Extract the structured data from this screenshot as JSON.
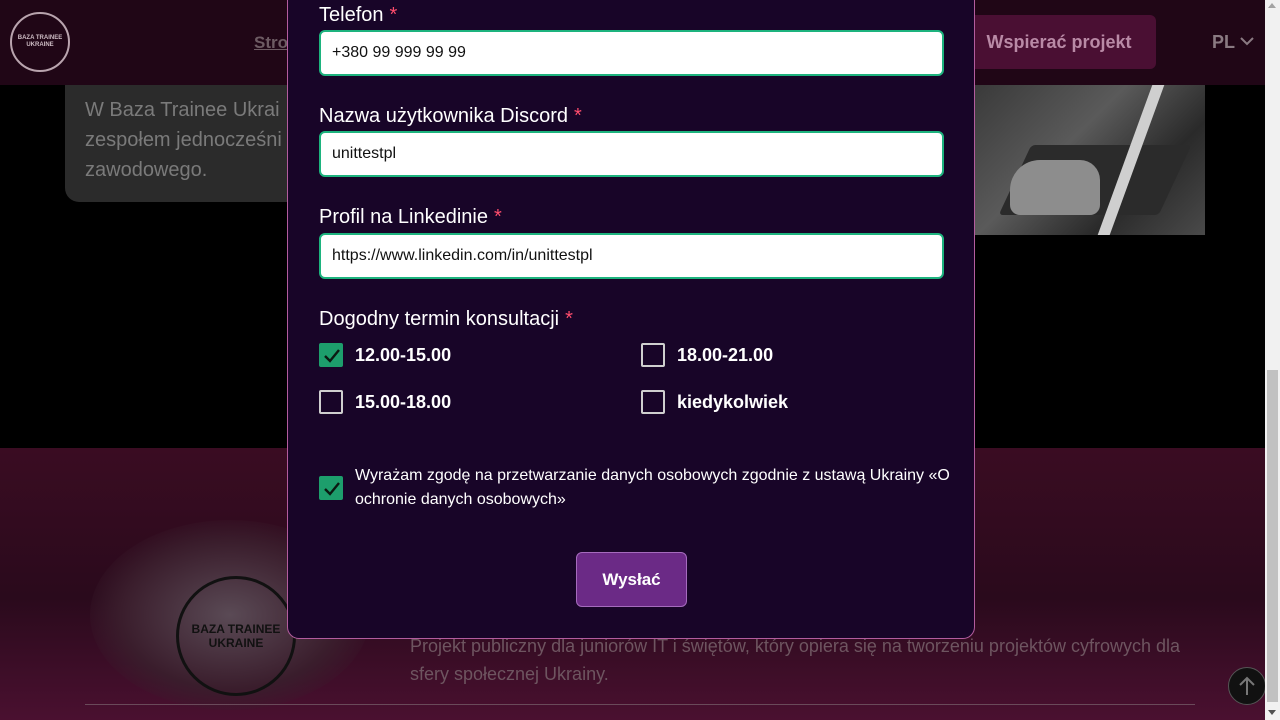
{
  "header": {
    "logo_text": "BAZA TRAINEE UKRAINE",
    "nav_link": "Stro",
    "support_label": "Wspierać projekt",
    "lang": "PL"
  },
  "about": {
    "text": "W Baza Trainee Ukrai zespołem jednocześni zawodowego."
  },
  "form": {
    "phone_label": "Telefon",
    "phone_value": "+380 99 999 99 99",
    "discord_label": "Nazwa użytkownika Discord",
    "discord_value": "unittestpl",
    "linkedin_label": "Profil na Linkedinie",
    "linkedin_value": "https://www.linkedin.com/in/unittestpl",
    "required_mark": "*",
    "time_label": "Dogodny termin konsultacji",
    "time_options": [
      {
        "label": "12.00-15.00",
        "checked": true
      },
      {
        "label": "18.00-21.00",
        "checked": false
      },
      {
        "label": "15.00-18.00",
        "checked": false
      },
      {
        "label": "kiedykolwiek",
        "checked": false
      }
    ],
    "consent_text": "Wyrażam zgodę na przetwarzanie danych osobowych zgodnie z ustawą Ukrainy «O ochronie danych osobowych»",
    "consent_checked": true,
    "submit_label": "Wysłać"
  },
  "footer": {
    "logo_text": "BAZA TRAINEE UKRAINE",
    "description": "Projekt publiczny dla juniorów IT i świętów, który opiera się na tworzeniu projektów cyfrowych dla sfery społecznej Ukrainy."
  },
  "colors": {
    "accent_green": "#1d9e6c",
    "modal_bg": "#180528",
    "button_purple": "#6b2a86"
  }
}
